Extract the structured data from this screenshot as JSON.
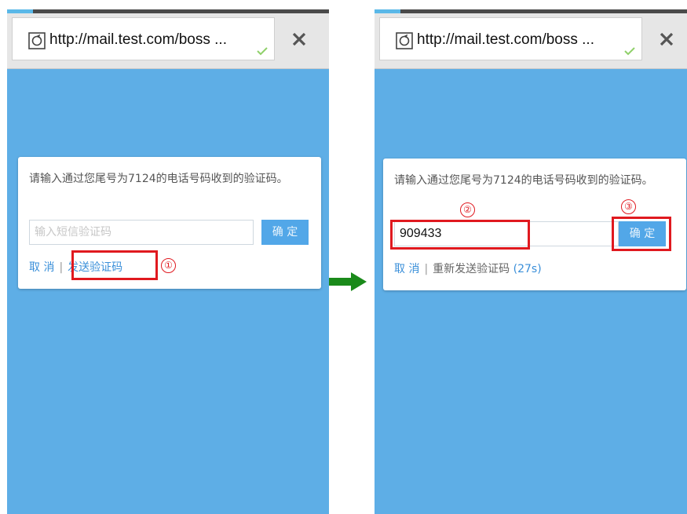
{
  "browser": {
    "url": "http://mail.test.com/boss ...",
    "progress_percent": 8
  },
  "dialog": {
    "prompt": "请输入通过您尾号为7124的电话号码收到的验证码。",
    "input_placeholder": "输入短信验证码",
    "confirm_label": "确 定",
    "cancel_label": "取 消",
    "separator": "|",
    "send_code_label": "发送验证码",
    "resend_label": "重新发送验证码",
    "countdown": "(27s)",
    "entered_code": "909433"
  },
  "annotations": {
    "step1": "①",
    "step2": "②",
    "step3": "③"
  },
  "colors": {
    "screen_bg": "#5eaee6",
    "button_bg": "#52a7e8",
    "link": "#3a8fd9",
    "annotation_red": "#e0191f",
    "arrow_green": "#1a8a1a"
  }
}
